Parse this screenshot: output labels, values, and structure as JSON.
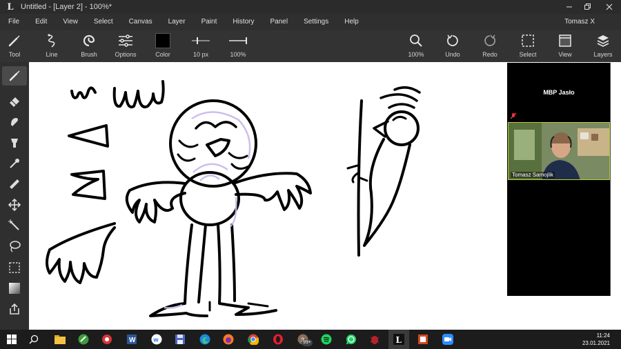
{
  "window": {
    "app_logo": "L",
    "title": "Untitled - [Layer 2] - 100%*",
    "controls": [
      "minimize",
      "maximize",
      "close"
    ]
  },
  "menu": {
    "items": [
      "File",
      "Edit",
      "View",
      "Select",
      "Canvas",
      "Layer",
      "Paint",
      "History",
      "Panel",
      "Settings",
      "Help"
    ],
    "user": "Tomasz X"
  },
  "toolbar": {
    "tool": "Tool",
    "line": "Line",
    "brush": "Brush",
    "options": "Options",
    "color": "Color",
    "color_value": "#000000",
    "size": "10 px",
    "opacity": "100%",
    "zoom": "100%",
    "undo": "Undo",
    "redo": "Redo",
    "select": "Select",
    "view": "View",
    "layers": "Layers"
  },
  "tools": [
    "brush-icon",
    "eraser-icon",
    "smudge-icon",
    "fill-bucket-icon",
    "eyedropper-icon",
    "ruler-icon",
    "move-icon",
    "magic-wand-icon",
    "lasso-icon",
    "rect-select-icon",
    "gradient-icon",
    "share-icon"
  ],
  "call": {
    "title": "MBP Jasło",
    "participant": "Tomasz Samojlik"
  },
  "taskbar": {
    "badge": "99+",
    "time": "11:24",
    "date": "23.01.2021"
  },
  "colors": {
    "ui_dark": "#2b2b2b",
    "toolbar": "#333333",
    "canvas": "#ffffff",
    "ink": "#000000",
    "lavender": "#c9b8e8",
    "tile_border": "#b8d23a"
  }
}
